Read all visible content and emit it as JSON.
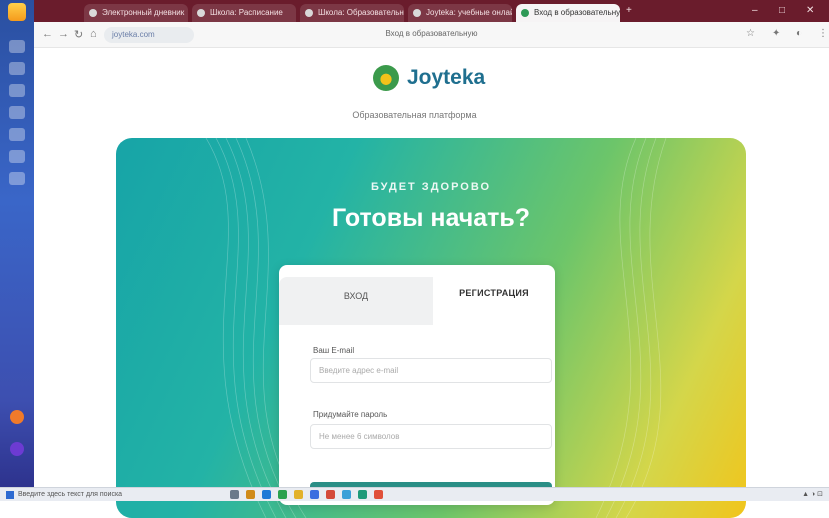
{
  "browser": {
    "tabs": [
      {
        "label": "Электронный дневник",
        "active": false
      },
      {
        "label": "Школа: Расписание",
        "active": false
      },
      {
        "label": "Школа: Образовательная",
        "active": false
      },
      {
        "label": "Joyteka: учебные онлайн",
        "active": false
      },
      {
        "label": "Вход в образовательную",
        "active": true
      }
    ],
    "url": "joyteka.com",
    "page_title": "Вход в образовательную"
  },
  "brand": {
    "name": "Joyteka",
    "subtitle": "Образовательная платформа"
  },
  "hero": {
    "kicker": "БУДЕТ ЗДОРОВО",
    "headline": "Готовы начать?"
  },
  "auth": {
    "tab_login": "ВХОД",
    "tab_register": "РЕГИСТРАЦИЯ",
    "email_label": "Ваш E-mail",
    "email_placeholder": "Введите адрес e-mail",
    "password_label": "Придумайте пароль",
    "password_placeholder": "Не менее 6 символов"
  },
  "taskbar": {
    "search_placeholder": "Введите здесь текст для поиска"
  },
  "colors": {
    "brand": "#1f6f8f",
    "hero_start": "#17a4a7",
    "hero_end": "#f1c51b",
    "tabbar": "#6a1c2c",
    "accent": "#2a8e86"
  }
}
